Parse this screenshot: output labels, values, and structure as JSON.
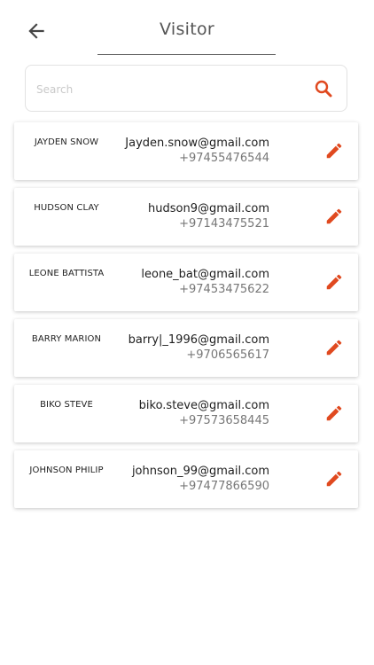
{
  "header": {
    "title": "Visitor"
  },
  "search": {
    "placeholder": "Search"
  },
  "colors": {
    "accent": "#e0491f"
  },
  "visitors": [
    {
      "name": "JAYDEN SNOW",
      "email": "Jayden.snow@gmail.com",
      "phone": "+97455476544"
    },
    {
      "name": "HUDSON CLAY",
      "email": "hudson9@gmail.com",
      "phone": "+97143475521"
    },
    {
      "name": "LEONE BATTISTA",
      "email": "leone_bat@gmail.com",
      "phone": "+97453475622"
    },
    {
      "name": "BARRY MARION",
      "email": "barry|_1996@gmail.com",
      "phone": "+9706565617"
    },
    {
      "name": "BIKO STEVE",
      "email": "biko.steve@gmail.com",
      "phone": "+97573658445"
    },
    {
      "name": "JOHNSON PHILIP",
      "email": "johnson_99@gmail.com",
      "phone": "+97477866590"
    }
  ]
}
